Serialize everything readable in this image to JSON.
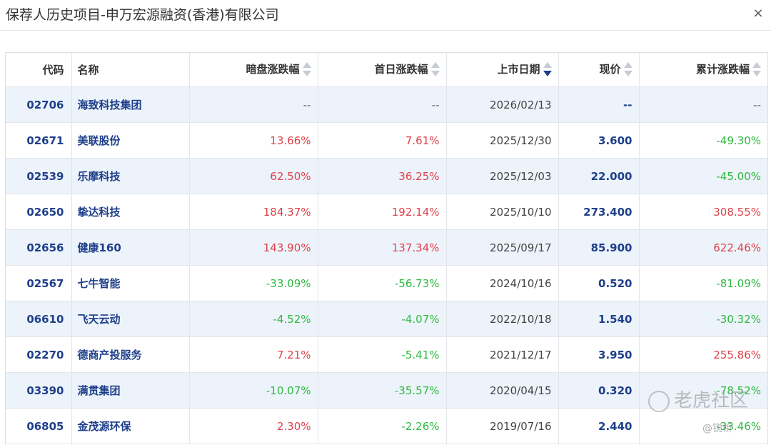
{
  "dialog": {
    "title": "保荐人历史项目-申万宏源融资(香港)有限公司",
    "close_label": "×"
  },
  "table": {
    "headers": {
      "code": "代码",
      "name": "名称",
      "grey_market": "暗盘涨跌幅",
      "first_day": "首日涨跌幅",
      "listing_date": "上市日期",
      "price": "现价",
      "cumulative": "累计涨跌幅"
    },
    "sorted_column": "listing_date",
    "sort_direction": "descending",
    "rows": [
      {
        "code": "02706",
        "name": "海致科技集团",
        "grey": "--",
        "first": "--",
        "date": "2026/02/13",
        "price": "--",
        "cum": "--"
      },
      {
        "code": "02671",
        "name": "美联股份",
        "grey": "13.66%",
        "first": "7.61%",
        "date": "2025/12/30",
        "price": "3.600",
        "cum": "-49.30%"
      },
      {
        "code": "02539",
        "name": "乐摩科技",
        "grey": "62.50%",
        "first": "36.25%",
        "date": "2025/12/03",
        "price": "22.000",
        "cum": "-45.00%"
      },
      {
        "code": "02650",
        "name": "挚达科技",
        "grey": "184.37%",
        "first": "192.14%",
        "date": "2025/10/10",
        "price": "273.400",
        "cum": "308.55%"
      },
      {
        "code": "02656",
        "name": "健康160",
        "grey": "143.90%",
        "first": "137.34%",
        "date": "2025/09/17",
        "price": "85.900",
        "cum": "622.46%"
      },
      {
        "code": "02567",
        "name": "七牛智能",
        "grey": "-33.09%",
        "first": "-56.73%",
        "date": "2024/10/16",
        "price": "0.520",
        "cum": "-81.09%"
      },
      {
        "code": "06610",
        "name": "飞天云动",
        "grey": "-4.52%",
        "first": "-4.07%",
        "date": "2022/10/18",
        "price": "1.540",
        "cum": "-30.32%"
      },
      {
        "code": "02270",
        "name": "德商产投服务",
        "grey": "7.21%",
        "first": "-5.41%",
        "date": "2021/12/17",
        "price": "3.950",
        "cum": "255.86%"
      },
      {
        "code": "03390",
        "name": "满贯集团",
        "grey": "-10.07%",
        "first": "-35.57%",
        "date": "2020/04/15",
        "price": "0.320",
        "cum": "-78.52%"
      },
      {
        "code": "06805",
        "name": "金茂源环保",
        "grey": "2.30%",
        "first": "-2.26%",
        "date": "2019/07/16",
        "price": "2.440",
        "cum": "-33.46%"
      }
    ]
  },
  "watermark": {
    "brand": "老虎社区",
    "handle": "@锐析"
  },
  "colors": {
    "up": "#e0414b",
    "down": "#2eb93f",
    "link": "#1e3f8a",
    "stripe": "#edf3fa"
  }
}
